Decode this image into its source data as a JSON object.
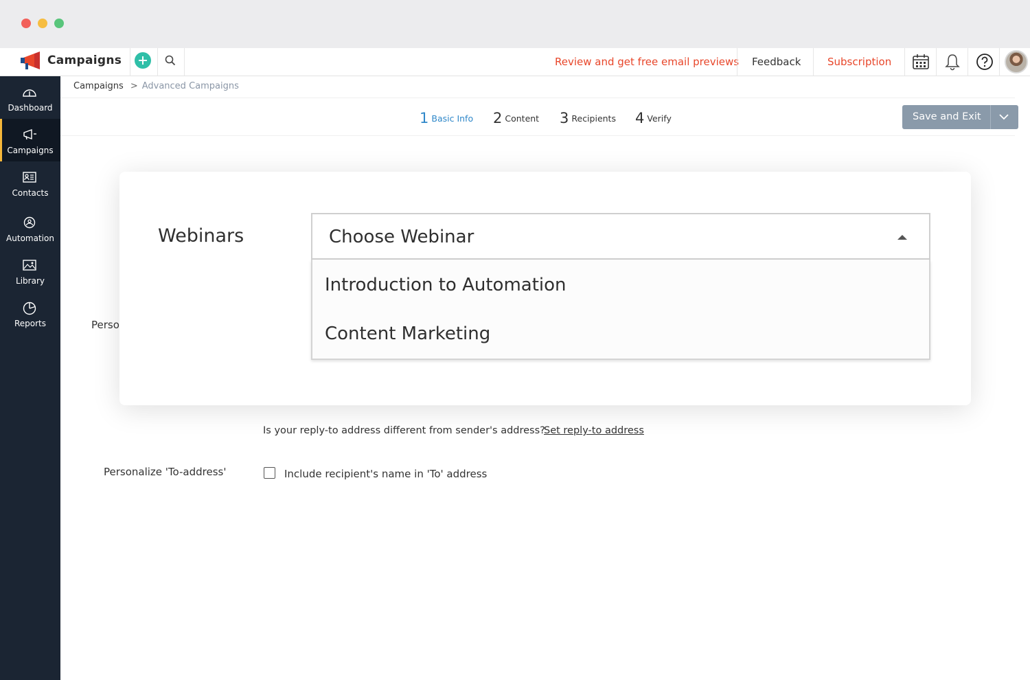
{
  "app": {
    "title": "Campaigns"
  },
  "topbar": {
    "promo_link": "Review and get free email previews",
    "feedback": "Feedback",
    "subscription": "Subscription",
    "icons": [
      "add-icon",
      "search-icon",
      "calendar-icon",
      "bell-icon",
      "help-icon",
      "avatar"
    ]
  },
  "sidebar": {
    "items": [
      {
        "label": "Dashboard",
        "icon": "dashboard-icon",
        "active": false
      },
      {
        "label": "Campaigns",
        "icon": "megaphone-icon",
        "active": true
      },
      {
        "label": "Contacts",
        "icon": "contacts-icon",
        "active": false
      },
      {
        "label": "Automation",
        "icon": "automation-icon",
        "active": false
      },
      {
        "label": "Library",
        "icon": "image-icon",
        "active": false
      },
      {
        "label": "Reports",
        "icon": "pie-chart-icon",
        "active": false
      }
    ]
  },
  "breadcrumb": {
    "root": "Campaigns",
    "separator": ">",
    "current": "Advanced Campaigns"
  },
  "steps": [
    {
      "num": "1",
      "label": "Basic Info",
      "active": true
    },
    {
      "num": "2",
      "label": "Content",
      "active": false
    },
    {
      "num": "3",
      "label": "Recipients",
      "active": false
    },
    {
      "num": "4",
      "label": "Verify",
      "active": false
    }
  ],
  "save_button": {
    "label": "Save and Exit"
  },
  "form": {
    "partial_label": "Perso",
    "reply_question": "Is your reply-to address different from sender's address?",
    "reply_link": "Set reply-to address",
    "personalize_label": "Personalize 'To-address'",
    "personalize_checkbox_label": "Include recipient's name in 'To' address",
    "personalize_checked": false
  },
  "modal": {
    "label": "Webinars",
    "select_placeholder": "Choose Webinar",
    "options": [
      "Introduction to Automation",
      "Content Marketing"
    ]
  },
  "colors": {
    "accent": "#2e87c9",
    "promo": "#e8462a",
    "sidebar_bg": "#1b2533",
    "sidebar_active_indicator": "#f5b73a",
    "add_button": "#2fbfa8",
    "save_button": "#8a9aaa"
  }
}
